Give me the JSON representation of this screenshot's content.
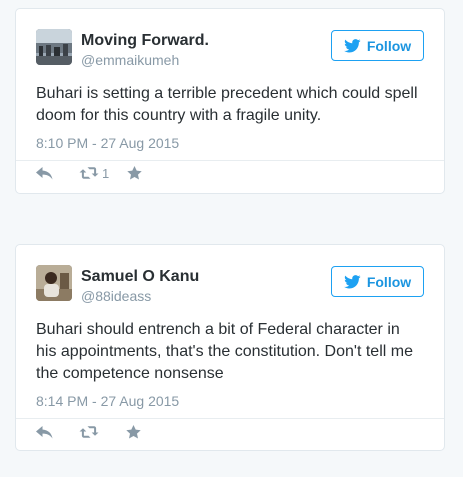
{
  "tweets": [
    {
      "display_name": "Moving Forward.",
      "handle": "@emmaikumeh",
      "follow_label": "Follow",
      "text": "Buhari is setting a terrible precedent which could spell doom for this country with a fragile unity.",
      "timestamp": "8:10 PM - 27 Aug 2015",
      "retweet_count": "1",
      "icons": [
        "reply-icon",
        "retweet-icon",
        "favorite-icon"
      ]
    },
    {
      "display_name": "Samuel O Kanu",
      "handle": "@88ideass",
      "follow_label": "Follow",
      "text": "Buhari should entrench a bit of Federal character in his appointments, that's the constitution. Don't tell me the competence nonsense",
      "timestamp": "8:14 PM - 27 Aug 2015",
      "retweet_count": "",
      "icons": [
        "reply-icon",
        "retweet-icon",
        "favorite-icon"
      ]
    }
  ],
  "colors": {
    "accent": "#1da1f2",
    "text": "#292f33",
    "muted": "#8899a6",
    "border": "#e1e8ed"
  }
}
